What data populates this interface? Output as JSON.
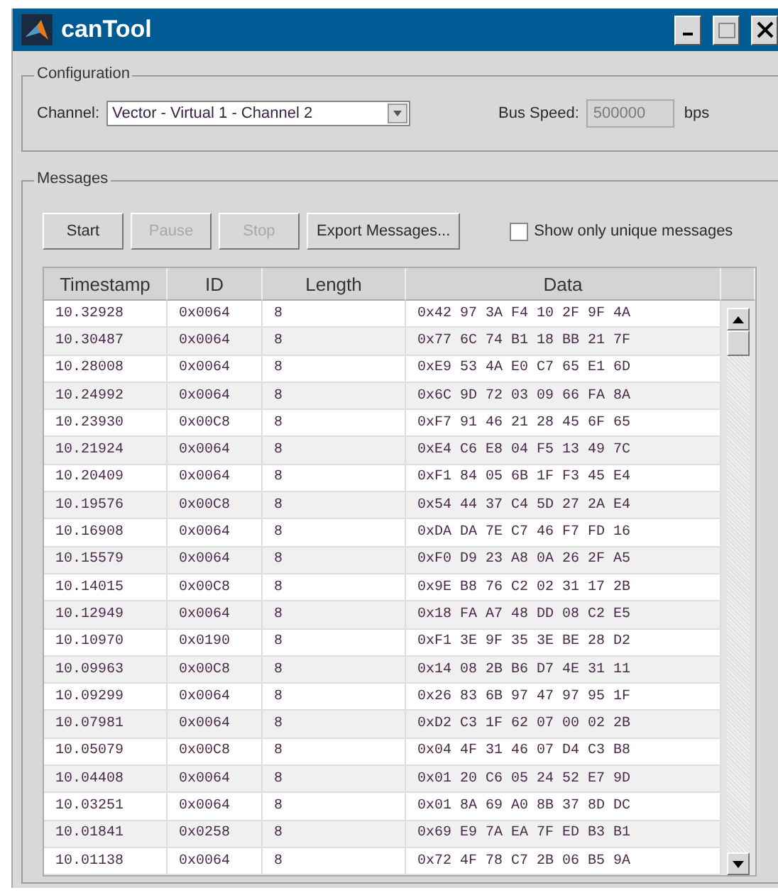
{
  "window": {
    "title": "canTool"
  },
  "configuration": {
    "title": "Configuration",
    "channel_label": "Channel:",
    "channel_value": "Vector -  Virtual 1 -  Channel 2",
    "bus_speed_label": "Bus Speed:",
    "bus_speed_value": "500000",
    "bus_speed_unit": "bps"
  },
  "messages": {
    "title": "Messages",
    "buttons": [
      {
        "label": "Start",
        "disabled": false
      },
      {
        "label": "Pause",
        "disabled": true
      },
      {
        "label": "Stop",
        "disabled": true
      },
      {
        "label": "Export Messages...",
        "disabled": false
      }
    ],
    "unique_checkbox": {
      "label": "Show only unique messages",
      "checked": false
    },
    "table": {
      "columns": [
        "Timestamp",
        "ID",
        "Length",
        "Data"
      ],
      "rows": [
        [
          "10.32928",
          "0x0064",
          "8",
          "0x42 97 3A F4 10 2F 9F 4A"
        ],
        [
          "10.30487",
          "0x0064",
          "8",
          "0x77 6C 74 B1 18 BB 21 7F"
        ],
        [
          "10.28008",
          "0x0064",
          "8",
          "0xE9 53 4A E0 C7 65 E1 6D"
        ],
        [
          "10.24992",
          "0x0064",
          "8",
          "0x6C 9D 72 03 09 66 FA 8A"
        ],
        [
          "10.23930",
          "0x00C8",
          "8",
          "0xF7 91 46 21 28 45 6F 65"
        ],
        [
          "10.21924",
          "0x0064",
          "8",
          "0xE4 C6 E8 04 F5 13 49 7C"
        ],
        [
          "10.20409",
          "0x0064",
          "8",
          "0xF1 84 05 6B 1F F3 45 E4"
        ],
        [
          "10.19576",
          "0x00C8",
          "8",
          "0x54 44 37 C4 5D 27 2A E4"
        ],
        [
          "10.16908",
          "0x0064",
          "8",
          "0xDA DA 7E C7 46 F7 FD 16"
        ],
        [
          "10.15579",
          "0x0064",
          "8",
          "0xF0 D9 23 A8 0A 26 2F A5"
        ],
        [
          "10.14015",
          "0x00C8",
          "8",
          "0x9E B8 76 C2 02 31 17 2B"
        ],
        [
          "10.12949",
          "0x0064",
          "8",
          "0x18 FA A7 48 DD 08 C2 E5"
        ],
        [
          "10.10970",
          "0x0190",
          "8",
          "0xF1 3E 9F 35 3E BE 28 D2"
        ],
        [
          "10.09963",
          "0x00C8",
          "8",
          "0x14 08 2B B6 D7 4E 31 11"
        ],
        [
          "10.09299",
          "0x0064",
          "8",
          "0x26 83 6B 97 47 97 95 1F"
        ],
        [
          "10.07981",
          "0x0064",
          "8",
          "0xD2 C3 1F 62 07 00 02 2B"
        ],
        [
          "10.05079",
          "0x00C8",
          "8",
          "0x04 4F 31 46 07 D4 C3 B8"
        ],
        [
          "10.04408",
          "0x0064",
          "8",
          "0x01 20 C6 05 24 52 E7 9D"
        ],
        [
          "10.03251",
          "0x0064",
          "8",
          "0x01 8A 69 A0 8B 37 8D DC"
        ],
        [
          "10.01841",
          "0x0258",
          "8",
          "0x69 E9 7A EA 7F ED B3 B1"
        ],
        [
          "10.01138",
          "0x0064",
          "8",
          "0x72 4F 78 C7 2B 06 B5 9A"
        ]
      ]
    }
  }
}
